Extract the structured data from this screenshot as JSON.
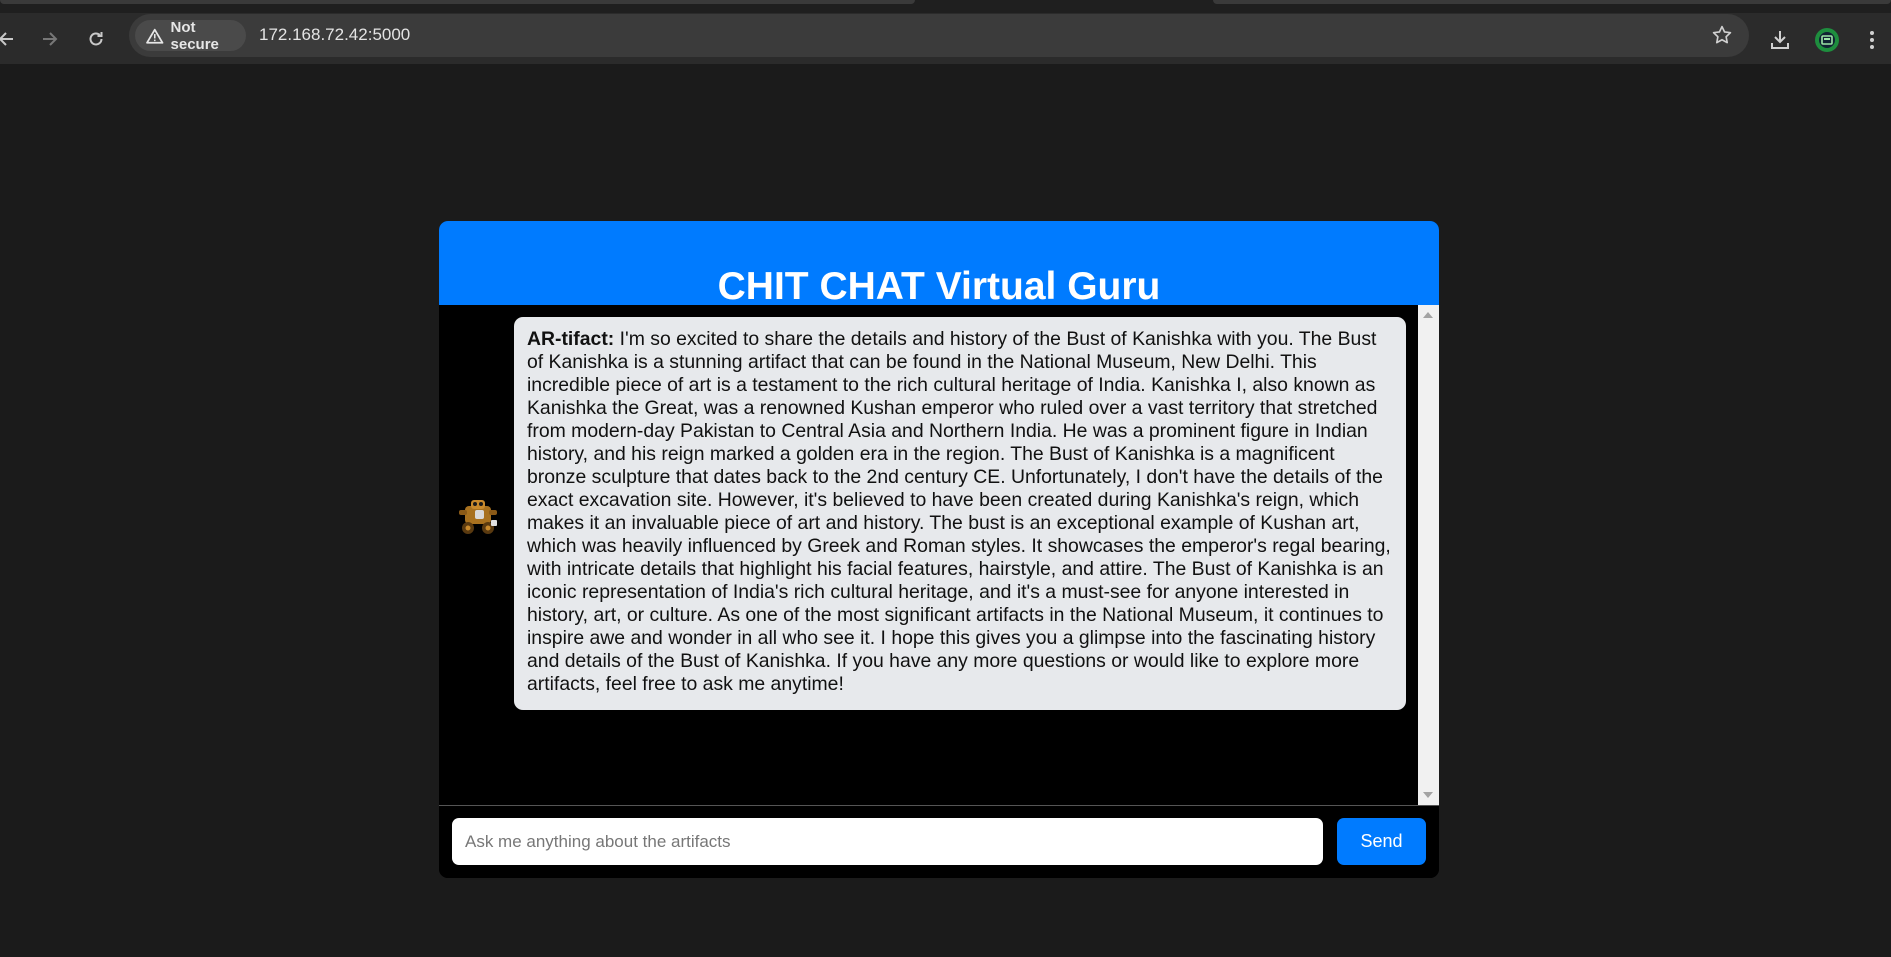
{
  "browser": {
    "security_label": "Not secure",
    "url": "172.168.72.42:5000"
  },
  "chat": {
    "title": "CHIT CHAT Virtual Guru",
    "messages": [
      {
        "sender": "AR-tifact:",
        "text": "I'm so excited to share the details and history of the Bust of Kanishka with you. The Bust of Kanishka is a stunning artifact that can be found in the National Museum, New Delhi. This incredible piece of art is a testament to the rich cultural heritage of India. Kanishka I, also known as Kanishka the Great, was a renowned Kushan emperor who ruled over a vast territory that stretched from modern-day Pakistan to Central Asia and Northern India. He was a prominent figure in Indian history, and his reign marked a golden era in the region. The Bust of Kanishka is a magnificent bronze sculpture that dates back to the 2nd century CE. Unfortunately, I don't have the details of the exact excavation site. However, it's believed to have been created during Kanishka's reign, which makes it an invaluable piece of art and history. The bust is an exceptional example of Kushan art, which was heavily influenced by Greek and Roman styles. It showcases the emperor's regal bearing, with intricate details that highlight his facial features, hairstyle, and attire. The Bust of Kanishka is an iconic representation of India's rich cultural heritage, and it's a must-see for anyone interested in history, art, or culture. As one of the most significant artifacts in the National Museum, it continues to inspire awe and wonder in all who see it. I hope this gives you a glimpse into the fascinating history and details of the Bust of Kanishka. If you have any more questions or would like to explore more artifacts, feel free to ask me anytime!"
      }
    ],
    "input": {
      "placeholder": "Ask me anything about the artifacts",
      "value": ""
    },
    "send_label": "Send"
  },
  "colors": {
    "accent": "#007bff",
    "page_background": "#1b1b1b",
    "bubble_background": "#e7e9ec"
  }
}
